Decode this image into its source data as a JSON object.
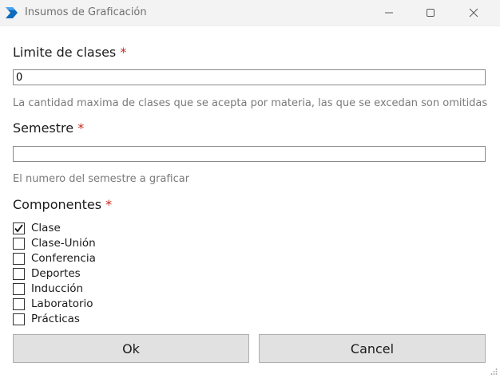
{
  "window": {
    "title": "Insumos de Graficación",
    "icon": "power-automate-chevron-icon",
    "accent": "#0f6cbd"
  },
  "form": {
    "limit": {
      "label": "Limite de clases",
      "required_mark": "*",
      "value": "0",
      "hint": "La cantidad maxima de clases que se acepta por materia, las que se excedan son omitidas"
    },
    "semester": {
      "label": "Semestre",
      "required_mark": "*",
      "value": "",
      "hint": "El numero del semestre a graficar"
    },
    "components": {
      "label": "Componentes",
      "required_mark": "*",
      "items": [
        {
          "label": "Clase",
          "checked": true
        },
        {
          "label": "Clase-Unión",
          "checked": false
        },
        {
          "label": "Conferencia",
          "checked": false
        },
        {
          "label": "Deportes",
          "checked": false
        },
        {
          "label": "Inducción",
          "checked": false
        },
        {
          "label": "Laboratorio",
          "checked": false
        },
        {
          "label": "Prácticas",
          "checked": false
        }
      ]
    }
  },
  "buttons": {
    "ok": "Ok",
    "cancel": "Cancel"
  }
}
